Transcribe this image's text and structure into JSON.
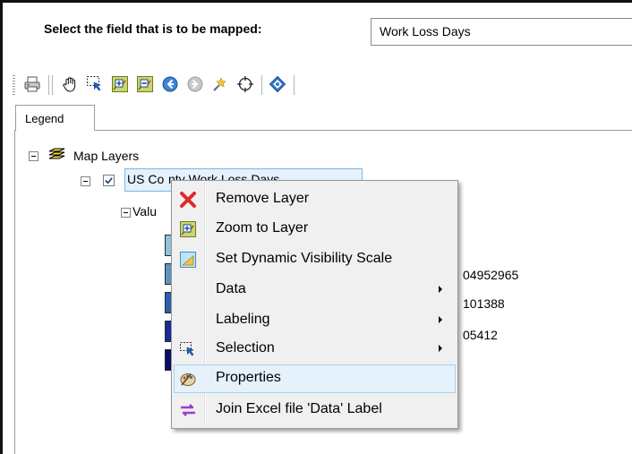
{
  "field_selector": {
    "label": "Select the field that is to be mapped:",
    "selected": "Work Loss Days"
  },
  "toolbar": {
    "icons": [
      "print-icon",
      "pan-hand-icon",
      "select-icon",
      "zoom-in-icon",
      "zoom-out-icon",
      "back-icon",
      "forward-icon",
      "identify-icon",
      "full-extent-icon",
      "layer-properties-icon"
    ]
  },
  "tabs": {
    "legend": "Legend"
  },
  "tree": {
    "root": "Map Layers",
    "layer": "US Co",
    "layer_suffix": "nty Work Loss Days",
    "values_node": "Valu"
  },
  "legend_values": [
    "04952965",
    "101388",
    "05412"
  ],
  "swatch_colors": [
    "#8fc3d9",
    "#5b93c4",
    "#2c5fae",
    "#1b2a9a",
    "#0b0b6b"
  ],
  "context_menu": {
    "items": [
      {
        "label": "Remove Layer",
        "icon": "remove-x-icon",
        "submenu": false
      },
      {
        "label": "Zoom to Layer",
        "icon": "zoom-to-layer-icon",
        "submenu": false
      },
      {
        "label": "Set Dynamic Visibility Scale",
        "icon": "visibility-scale-icon",
        "submenu": false
      },
      {
        "label": "Data",
        "icon": "",
        "submenu": true
      },
      {
        "label": "Labeling",
        "icon": "",
        "submenu": true
      },
      {
        "label": "Selection",
        "icon": "selection-arrow-icon",
        "submenu": true
      },
      {
        "label": "Properties",
        "icon": "properties-palette-icon",
        "submenu": false,
        "highlighted": true
      },
      {
        "label": "Join Excel file 'Data' Label",
        "icon": "join-arrows-icon",
        "submenu": false
      }
    ]
  },
  "colors": {
    "highlight_bg": "#e5f1fb",
    "highlight_border": "#a8d2f5",
    "menu_bg": "#f0f0f0"
  }
}
